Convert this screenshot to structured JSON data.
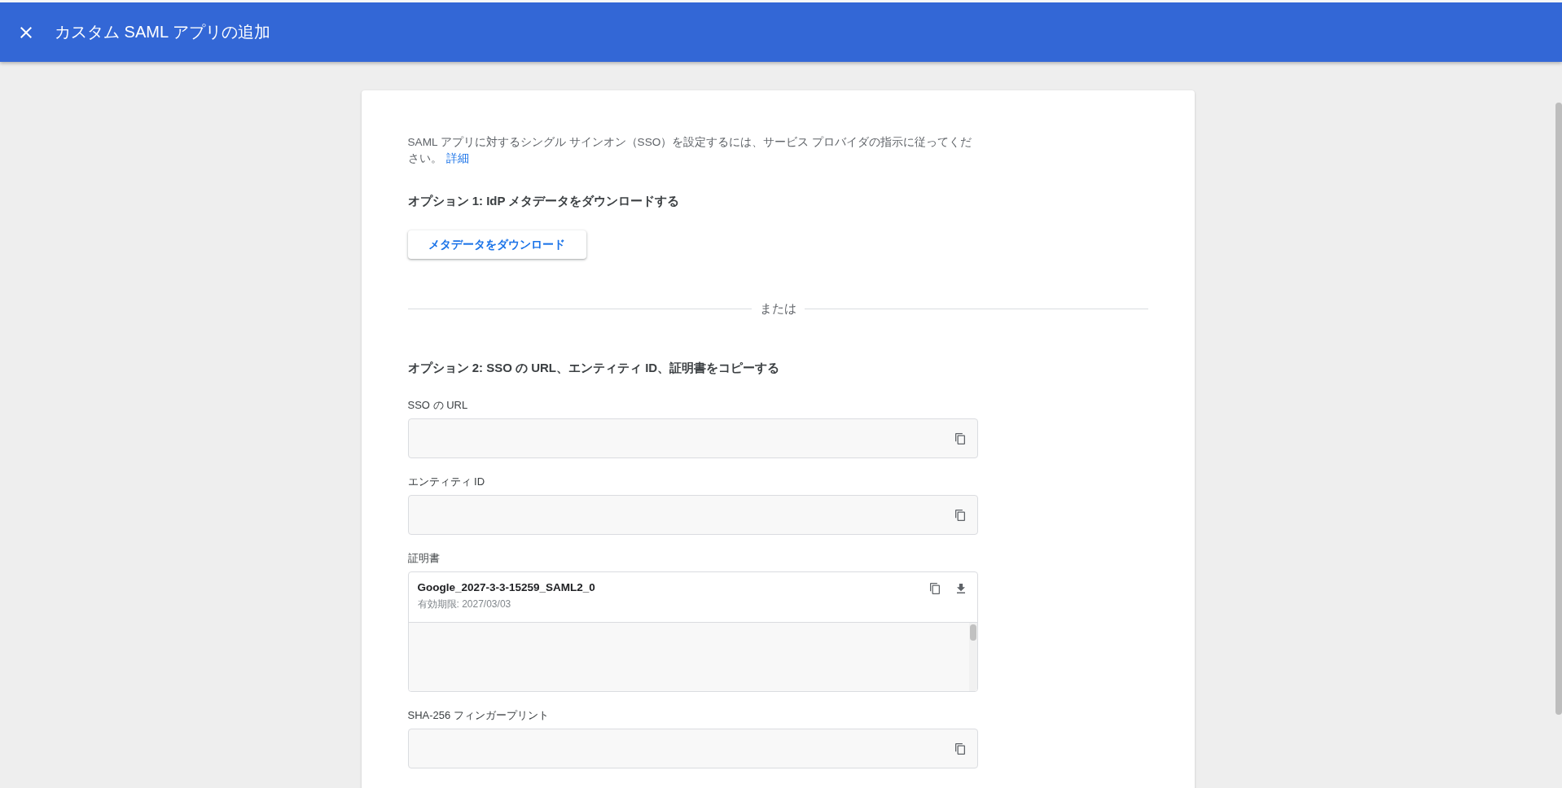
{
  "header": {
    "title": "カスタム SAML アプリの追加"
  },
  "intro": {
    "text": "SAML アプリに対するシングル サインオン（SSO）を設定するには、サービス プロバイダの指示に従ってください。",
    "link": "詳細"
  },
  "option_1": {
    "heading": "オプション 1: IdP メタデータをダウンロードする",
    "button": "メタデータをダウンロード"
  },
  "divider": {
    "label": "または"
  },
  "option_2": {
    "heading": "オプション 2: SSO の URL、エンティティ ID、証明書をコピーする",
    "fields": [
      {
        "kind": "copy",
        "label": "SSO の URL"
      },
      {
        "kind": "copy",
        "label": "エンティティ ID"
      },
      {
        "kind": "certificate",
        "label": "証明書",
        "name": "Google_2027-3-3-15259_SAML2_0",
        "expiry": "有効期限: 2027/03/03"
      },
      {
        "kind": "copy",
        "label": "SHA-256 フィンガープリント"
      }
    ]
  }
}
